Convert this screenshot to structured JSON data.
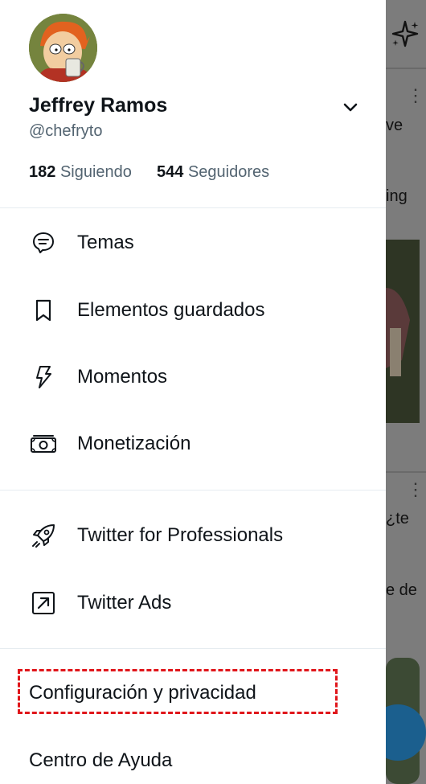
{
  "profile": {
    "name": "Jeffrey Ramos",
    "handle": "@chefryto",
    "following_count": "182",
    "following_label": "Siguiendo",
    "followers_count": "544",
    "followers_label": "Seguidores"
  },
  "menu": {
    "topics": "Temas",
    "bookmarks": "Elementos guardados",
    "moments": "Momentos",
    "monetization": "Monetización",
    "professionals": "Twitter for Professionals",
    "ads": "Twitter Ads",
    "settings": "Configuración y privacidad",
    "help": "Centro de Ayuda"
  },
  "background_feed": {
    "snippet_1": "ve",
    "snippet_2": "ing",
    "snippet_3": "¿te",
    "snippet_4": "e de"
  },
  "colors": {
    "text_primary": "#0f1419",
    "text_secondary": "#536471",
    "highlight_border": "#e0161b",
    "divider": "#e6ecf0"
  },
  "icons": [
    "sparkle-icon",
    "chevron-down-icon",
    "topics-icon",
    "bookmark-icon",
    "lightning-icon",
    "money-icon",
    "rocket-icon",
    "external-arrow-icon"
  ]
}
